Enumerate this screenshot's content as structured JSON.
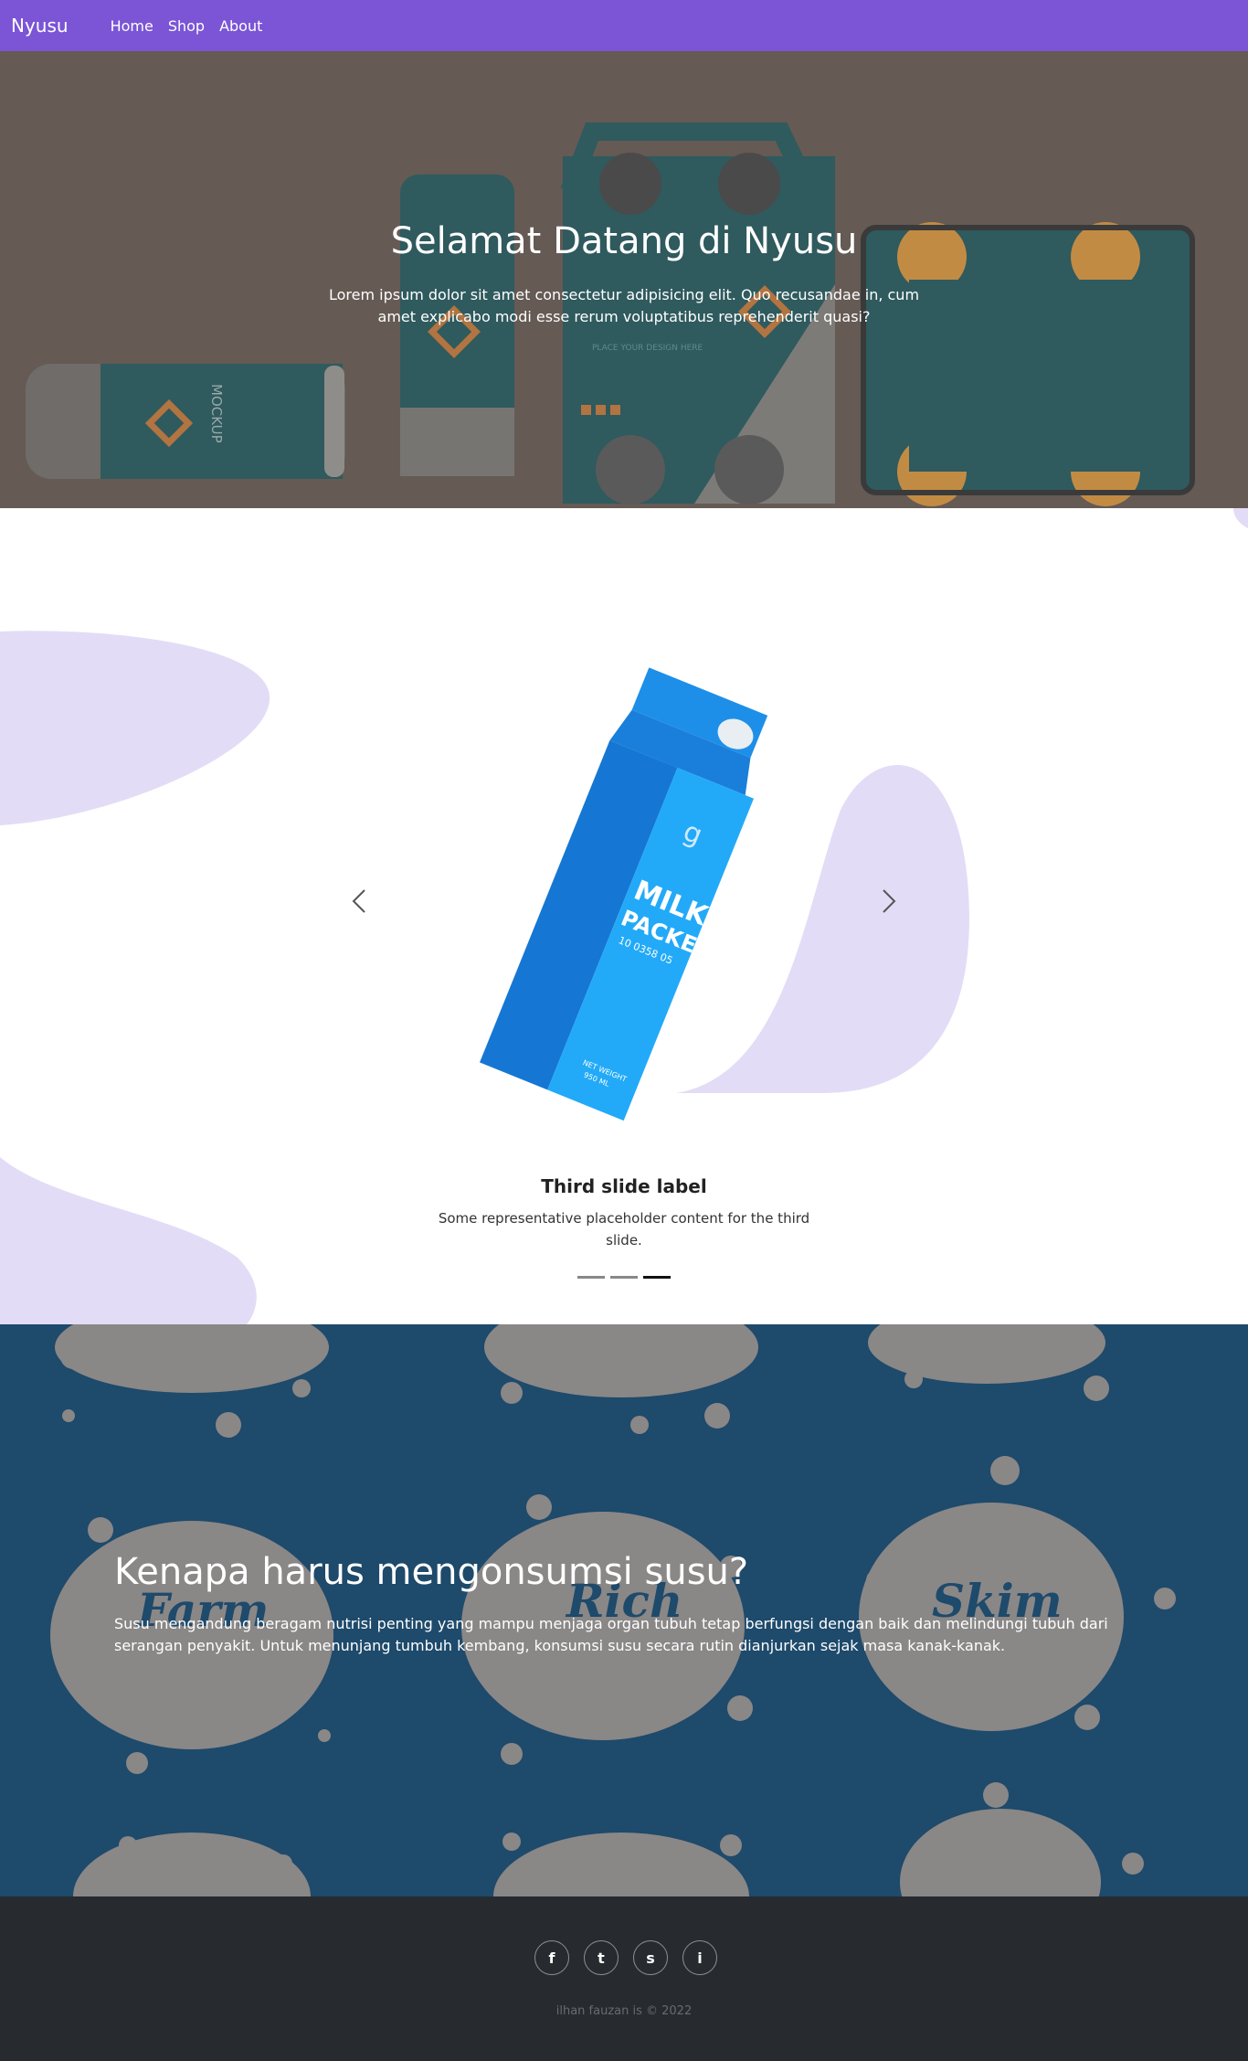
{
  "navbar": {
    "brand": "Nyusu",
    "links": [
      "Home",
      "Shop",
      "About"
    ]
  },
  "hero": {
    "title": "Selamat Datang di Nyusu",
    "text": "Lorem ipsum dolor sit amet consectetur adipisicing elit. Quo recusandae in, cum amet explicabo modi esse rerum voluptatibus reprehenderit quasi?",
    "mockup_label": "MOCKUP",
    "mockup_sub": "PLACE YOUR DESIGN HERE"
  },
  "carousel": {
    "caption_title": "Third slide label",
    "caption_text": "Some representative placeholder content for the third slide.",
    "indicator_count": 3,
    "active_index": 2,
    "product": {
      "logo": "g",
      "name_line1": "MILK",
      "name_line2": "PACKET",
      "code": "10 0358 05",
      "weight": "NET WEIGHT",
      "volume": "950 ML"
    }
  },
  "why": {
    "title": "Kenapa harus mengonsumsi susu?",
    "text": "Susu mengandung beragam nutrisi penting yang mampu menjaga organ tubuh tetap berfungsi dengan baik dan melindungi tubuh dari serangan penyakit. Untuk menunjang tumbuh kembang, konsumsi susu secara rutin dianjurkan sejak masa kanak-kanak.",
    "splash_labels": [
      "Farm milk",
      "Rich milk",
      "Skim milk"
    ]
  },
  "footer": {
    "social_icons": [
      "facebook-icon",
      "twitter-icon",
      "snapchat-icon",
      "instagram-icon"
    ],
    "social_glyphs": [
      "f",
      "t",
      "s",
      "i"
    ],
    "copyright": "ilhan fauzan is © 2022"
  },
  "colors": {
    "navbar": "#7b55d6",
    "hero_bg": "#655a54",
    "blob": "#e3dcf6",
    "why_bg": "#1e4a6b",
    "splash": "#8a8787",
    "footer_bg": "#272b30"
  }
}
